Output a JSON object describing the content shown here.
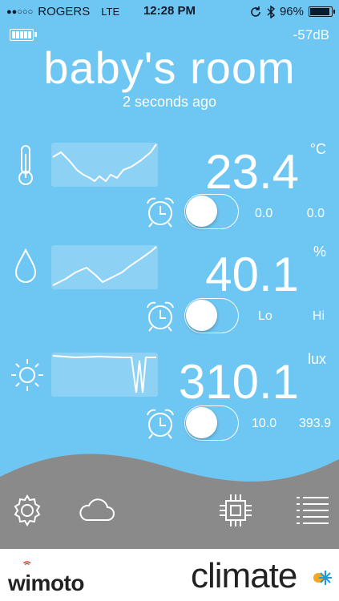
{
  "status_bar": {
    "signal": "●●○○○",
    "carrier": "ROGERS",
    "network": "LTE",
    "time": "12:28 PM",
    "battery": "96%",
    "battery_level": 0.96
  },
  "header": {
    "device_battery_icon": "battery-full-icon",
    "signal_strength": "-57dB",
    "room_name": "baby's room",
    "last_updated": "2 seconds ago"
  },
  "sensors": [
    {
      "icon": "thermometer-icon",
      "reading": "23.4",
      "unit": "°C",
      "alarm_on": false,
      "threshold_low": "0.0",
      "threshold_high": "0.0"
    },
    {
      "icon": "humidity-drop-icon",
      "reading": "40.1",
      "unit": "%",
      "alarm_on": false,
      "threshold_low": "Lo",
      "threshold_high": "Hi"
    },
    {
      "icon": "sun-icon",
      "reading": "310.1",
      "unit": "lux",
      "alarm_on": false,
      "threshold_low": "10.0",
      "threshold_high": "393.9"
    }
  ],
  "toolbar": {
    "items": [
      "settings-gear-icon",
      "cloud-icon",
      "chip-icon",
      "list-icon"
    ]
  },
  "footer": {
    "brand": "wimoto",
    "product": "climate"
  },
  "colors": {
    "background": "#6ec6f3",
    "toolbar": "#8a8a8a",
    "footer": "#ffffff",
    "text": "#ffffff"
  }
}
